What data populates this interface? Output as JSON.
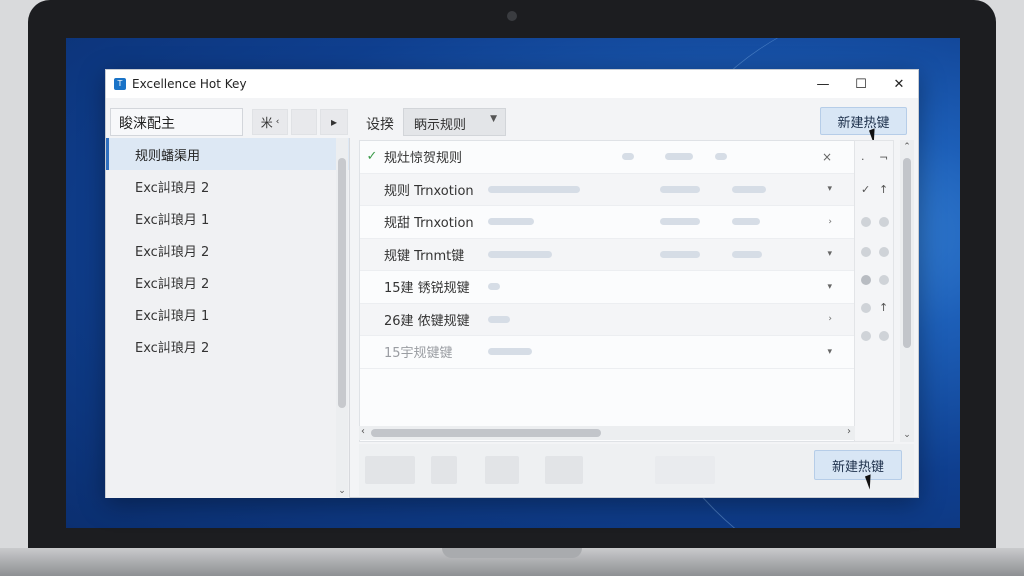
{
  "window": {
    "title": "Excellence Hot Key",
    "icon_glyph": "T",
    "controls": {
      "minimize": "—",
      "maximize": "☐",
      "close": "✕"
    }
  },
  "left": {
    "search_value": "睃涞配主",
    "mini_btn_1": "米",
    "mini_btn_1_caret": "‹",
    "mini_btn_2": "▸",
    "items": [
      {
        "label": "规则蟠渠用",
        "selected": true
      },
      {
        "label": "Exc訆琅月 2"
      },
      {
        "label": "Exc訆琅月 1"
      },
      {
        "label": "Exc訆琅月 2"
      },
      {
        "label": "Exc訆琅月 2"
      },
      {
        "label": "Exc訆琅月 1"
      },
      {
        "label": "Exc訆琅月 2"
      }
    ]
  },
  "toolbar": {
    "settings_label": "设揆",
    "rule_select_value": "眪示规则",
    "new_hotkey_top": "新建热键",
    "new_hotkey_bottom": "新建热键"
  },
  "rules": [
    {
      "check": "✓",
      "name": "规灶惊贺规则",
      "trailing": "×"
    },
    {
      "check": "",
      "name": "规则 Trnxotion",
      "trailing": "▾"
    },
    {
      "check": "",
      "name": "规甜 Trnxotion",
      "trailing": "›"
    },
    {
      "check": "",
      "name": "规键 Trnmt键",
      "trailing": "▾"
    },
    {
      "check": "",
      "name": "15建 锈锐规键",
      "trailing": "▾"
    },
    {
      "check": "",
      "name": "26建 侬键规键",
      "trailing": "›"
    },
    {
      "check": "",
      "name": "15宇规键键",
      "trailing": "▾",
      "dim": true
    }
  ],
  "rail": {
    "check": "✓",
    "up": "↑",
    "dash": "¬"
  },
  "icons": [
    "app-icon",
    "caret-down-icon",
    "checkmark-icon",
    "close-icon",
    "cursor-icon"
  ]
}
